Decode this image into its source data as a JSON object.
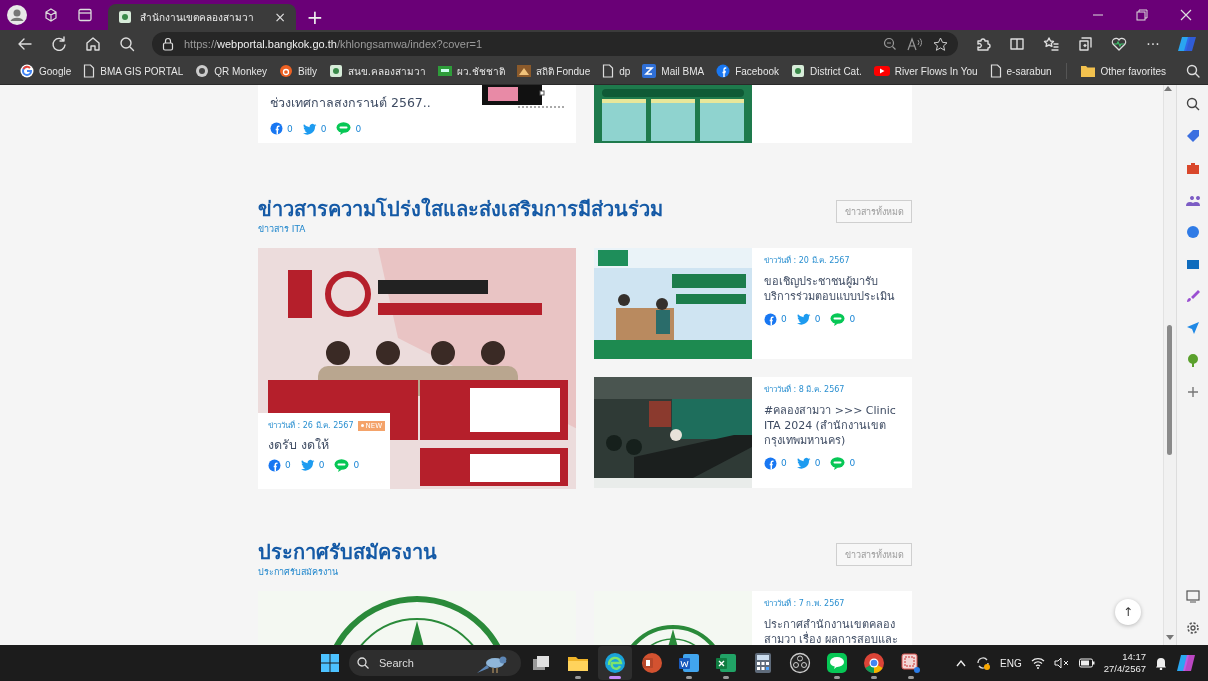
{
  "browser": {
    "tab": {
      "title": "สำนักงานเขตคลองสามวา",
      "close": "×",
      "selected": true
    },
    "new_tab": "+",
    "url": {
      "scheme": "https://",
      "host": "webportal.bangkok.go.th",
      "path": "/khlongsamwa/index?cover=1"
    },
    "more": "···",
    "bookmarks": [
      {
        "label": "Google"
      },
      {
        "label": "BMA GIS PORTAL"
      },
      {
        "label": "QR Monkey"
      },
      {
        "label": "Bitly"
      },
      {
        "label": "สนข.คลองสามวา"
      },
      {
        "label": "ผว.ชัชชาติ"
      },
      {
        "label": "สถิติ Fondue"
      },
      {
        "label": "dp"
      },
      {
        "label": "Mail BMA"
      },
      {
        "label": "Facebook"
      },
      {
        "label": "District Cat."
      },
      {
        "label": "River Flows In You"
      },
      {
        "label": "e-sarabun"
      }
    ],
    "other_favorites": "Other favorites"
  },
  "page": {
    "top_cards": [
      {
        "title": "ช่วงเทศกาลสงกรานต์ 2567..",
        "shares": [
          {
            "kind": "facebook",
            "count": "0"
          },
          {
            "kind": "twitter",
            "count": "0"
          },
          {
            "kind": "line",
            "count": "0"
          }
        ]
      },
      {
        "kind": "picture"
      }
    ],
    "sections": [
      {
        "title": "ข่าวสารความโปร่งใสและส่งเสริมการมีส่วนร่วม",
        "subtitle": "ข่าวสาร ITA",
        "more_button": "ข่าวสารทั้งหมด",
        "featured": {
          "kind": "overlay",
          "date": "ข่าววันที่ : 26 มี.ค. 2567",
          "badge": "NEW",
          "title": "งดรับ งดให้",
          "shares": [
            {
              "kind": "facebook",
              "count": "0"
            },
            {
              "kind": "twitter",
              "count": "0"
            },
            {
              "kind": "line",
              "count": "0"
            }
          ]
        },
        "items": [
          {
            "date": "ข่าววันที่ : 20 มี.ค. 2567",
            "title": "ขอเชิญประชาชนผู้มารับบริการร่วมตอบแบบประเมิน",
            "shares": [
              {
                "kind": "facebook",
                "count": "0"
              },
              {
                "kind": "twitter",
                "count": "0"
              },
              {
                "kind": "line",
                "count": "0"
              }
            ]
          },
          {
            "date": "ข่าววันที่ : 8 มี.ค. 2567",
            "title": "#คลองสามวา >>> Clinic ITA 2024 (สำนักงานเขตกรุงเทพมหานคร)",
            "shares": [
              {
                "kind": "facebook",
                "count": "0"
              },
              {
                "kind": "twitter",
                "count": "0"
              },
              {
                "kind": "line",
                "count": "0"
              }
            ]
          }
        ]
      },
      {
        "title": "ประกาศรับสมัครงาน",
        "subtitle": "ประกาศรับสมัครงาน",
        "more_button": "ข่าวสารทั้งหมด",
        "featured": {
          "kind": "picture"
        },
        "items": [
          {
            "date": "ข่าววันที่ : 7 ก.พ. 2567",
            "title": "ประกาศสำนักงานเขตคลองสามวา เรื่อง ผลการสอบและ"
          }
        ]
      }
    ],
    "back_to_top": "↑"
  },
  "taskbar": {
    "search_placeholder": "Search",
    "apps": [
      {
        "kind": "taskview",
        "running": false,
        "selected": false
      },
      {
        "kind": "explorer",
        "running": true,
        "selected": false
      },
      {
        "kind": "edge",
        "running": true,
        "selected": true
      },
      {
        "kind": "powerpoint",
        "running": false,
        "selected": false
      },
      {
        "kind": "word",
        "running": true,
        "selected": false
      },
      {
        "kind": "excel",
        "running": true,
        "selected": false
      },
      {
        "kind": "calculator",
        "running": false,
        "selected": false
      },
      {
        "kind": "obs",
        "running": false,
        "selected": false
      },
      {
        "kind": "line",
        "running": true,
        "selected": false
      },
      {
        "kind": "chrome",
        "running": true,
        "selected": false
      },
      {
        "kind": "snip",
        "running": true,
        "selected": false
      }
    ],
    "language": "ENG",
    "time": "14:17",
    "date": "27/4/2567"
  }
}
